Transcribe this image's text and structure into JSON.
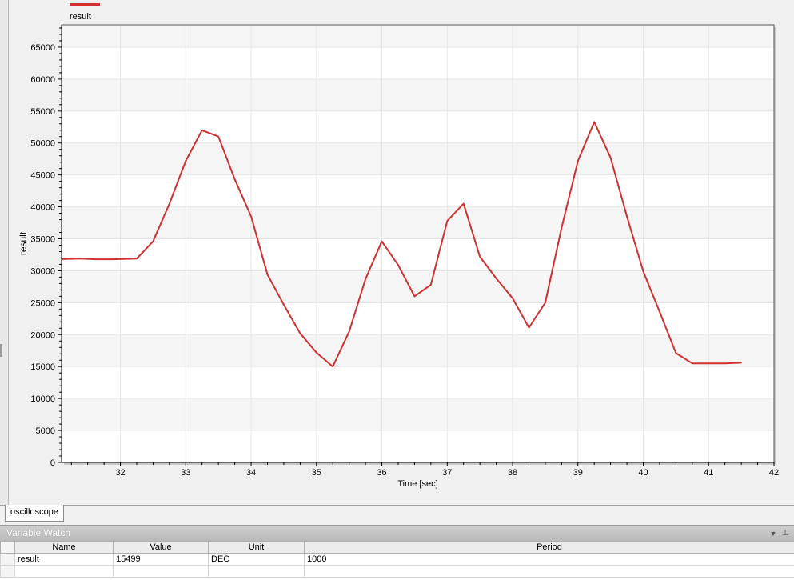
{
  "legend": {
    "label": "result",
    "color": "#d03030"
  },
  "chart_data": {
    "type": "line",
    "title": "",
    "xlabel": "Time [sec]",
    "ylabel": "result",
    "xlim": [
      31.1,
      42.0
    ],
    "ylim": [
      0,
      68500
    ],
    "x_ticks": [
      32,
      33,
      34,
      35,
      36,
      37,
      38,
      39,
      40,
      41,
      42
    ],
    "y_ticks": [
      0,
      5000,
      10000,
      15000,
      20000,
      25000,
      30000,
      35000,
      40000,
      45000,
      50000,
      55000,
      60000,
      65000
    ],
    "grid": true,
    "legend_position": "top-left",
    "series": [
      {
        "name": "result",
        "color": "#d03030",
        "x": [
          31.0,
          31.38,
          31.63,
          31.88,
          32.25,
          32.5,
          32.75,
          33.0,
          33.25,
          33.5,
          33.75,
          34.0,
          34.25,
          34.5,
          34.75,
          35.0,
          35.25,
          35.5,
          35.75,
          36.0,
          36.25,
          36.5,
          36.75,
          37.0,
          37.25,
          37.5,
          37.75,
          38.0,
          38.25,
          38.5,
          38.75,
          39.0,
          39.25,
          39.5,
          39.75,
          40.0,
          40.25,
          40.5,
          40.75,
          41.0,
          41.25,
          41.5
        ],
        "y": [
          31800,
          31900,
          31800,
          31800,
          31900,
          34600,
          40500,
          47200,
          52000,
          51000,
          44300,
          38500,
          29400,
          24700,
          20200,
          17200,
          15000,
          20500,
          28700,
          34600,
          30900,
          26000,
          27800,
          37800,
          40500,
          32200,
          28800,
          25700,
          21100,
          25000,
          36700,
          47200,
          53300,
          47700,
          38500,
          29900,
          23600,
          17100,
          15500,
          15500,
          15500,
          15600
        ]
      }
    ]
  },
  "tabs": [
    {
      "label": "oscilloscope"
    }
  ],
  "variable_watch": {
    "title": "Variable Watch",
    "dropdown_icon": "chevron-down-icon",
    "pin_icon": "pin-icon",
    "columns": [
      "Name",
      "Value",
      "Unit",
      "Period"
    ],
    "rows": [
      {
        "name": "result",
        "value": "15499",
        "unit": "DEC",
        "period": "1000"
      }
    ]
  }
}
